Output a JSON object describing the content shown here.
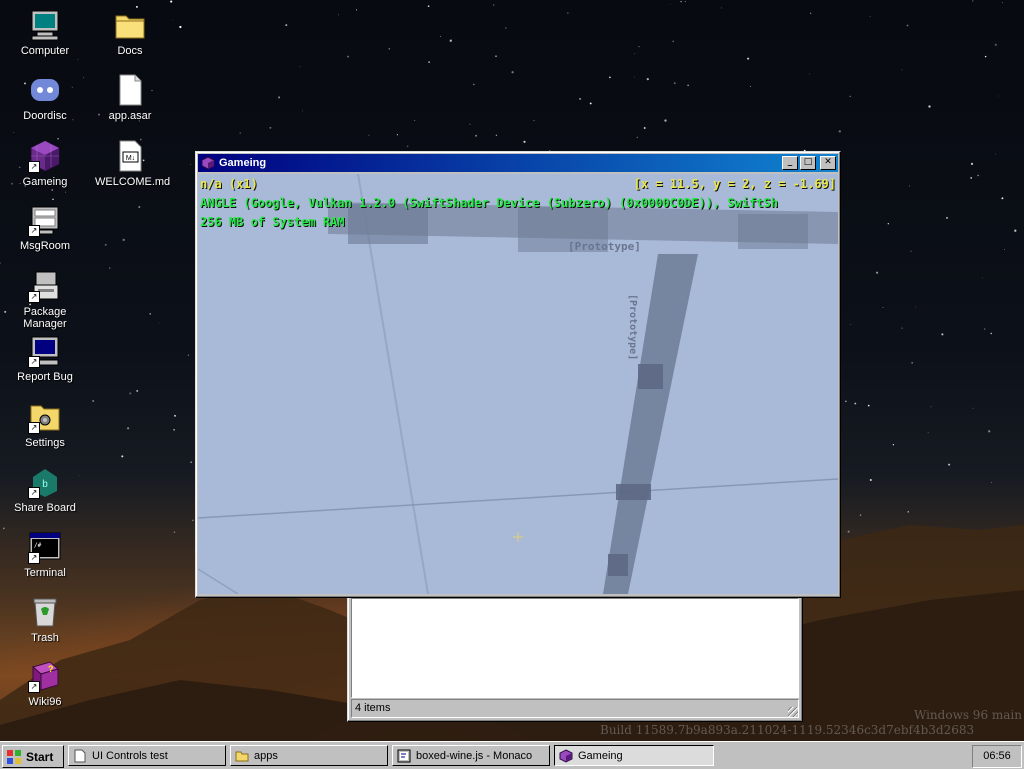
{
  "desktop": {
    "icons": [
      {
        "label": "Computer",
        "icon": "computer-icon"
      },
      {
        "label": "Docs",
        "icon": "folder-icon"
      },
      {
        "label": "Doordisc",
        "icon": "discord-icon"
      },
      {
        "label": "app.asar",
        "icon": "file-icon"
      },
      {
        "label": "Gameing",
        "icon": "cube-icon"
      },
      {
        "label": "WELCOME.md",
        "icon": "markdown-file-icon"
      },
      {
        "label": "MsgRoom",
        "icon": "msgroom-icon"
      },
      {
        "label": "Package Manager",
        "icon": "package-manager-icon"
      },
      {
        "label": "Report Bug",
        "icon": "report-bug-icon"
      },
      {
        "label": "Settings",
        "icon": "settings-icon"
      },
      {
        "label": "Share Board",
        "icon": "share-board-icon"
      },
      {
        "label": "Terminal",
        "icon": "terminal-icon"
      },
      {
        "label": "Trash",
        "icon": "trash-icon"
      },
      {
        "label": "Wiki96",
        "icon": "wiki-book-icon"
      }
    ]
  },
  "game_window": {
    "title": "Gameing",
    "hud": {
      "renderer_mode": "n/a (x1)",
      "coords": "[x = 11.5, y = 2, z = -1.69]",
      "gpu": "ANGLE (Google, Vulkan 1.2.0 (SwiftShader Device (Subzero) (0x0000C0DE)), SwiftSh",
      "ram": "256 MB of System RAM"
    },
    "scene_labels": [
      "[Prototype]",
      "[Prototype]"
    ],
    "colors": {
      "hud_yellow": "#e8e84a",
      "hud_green": "#29e84a",
      "scene_bg": "#a9bad8"
    }
  },
  "explorer_window": {
    "status": "4 items"
  },
  "watermark": {
    "line1": "Windows 96 main",
    "line2": "Build 11589.7b9a893a.211024-1119.52346c3d7ebf4b3d2683"
  },
  "taskbar": {
    "start_label": "Start",
    "tasks": [
      {
        "label": "UI Controls test",
        "icon": "document-icon",
        "active": false
      },
      {
        "label": "apps",
        "icon": "folder-icon",
        "active": false
      },
      {
        "label": "boxed-wine.js - Monaco",
        "icon": "code-editor-icon",
        "active": false
      },
      {
        "label": "Gameing",
        "icon": "cube-icon",
        "active": true
      }
    ],
    "clock": "06:56"
  }
}
